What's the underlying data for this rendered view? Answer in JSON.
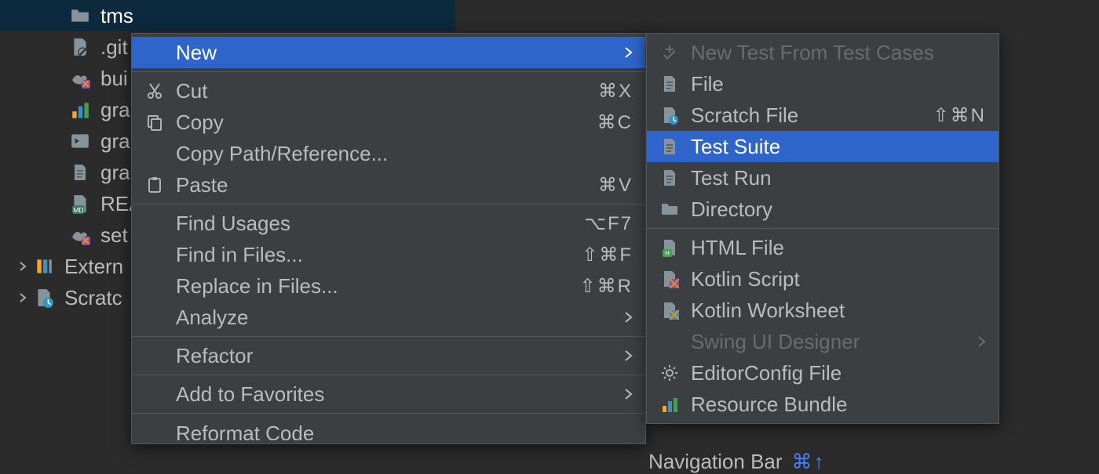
{
  "tree": {
    "selected": "tms",
    "items": [
      {
        "label": "tms",
        "icon": "folder",
        "selected": true,
        "indent": 1,
        "arrow": ""
      },
      {
        "label": ".git",
        "icon": "gitignore",
        "indent": 1,
        "arrow": ""
      },
      {
        "label": "bui",
        "icon": "gradle-kotlin",
        "indent": 1,
        "arrow": ""
      },
      {
        "label": "gra",
        "icon": "gradle-bars",
        "indent": 1,
        "arrow": ""
      },
      {
        "label": "gra",
        "icon": "terminal",
        "indent": 1,
        "arrow": ""
      },
      {
        "label": "gra",
        "icon": "file-lines",
        "indent": 1,
        "arrow": ""
      },
      {
        "label": "REA",
        "icon": "markdown",
        "indent": 1,
        "arrow": ""
      },
      {
        "label": "set",
        "icon": "gradle-kotlin",
        "indent": 1,
        "arrow": ""
      },
      {
        "label": "Extern",
        "icon": "external-lib",
        "indent": 0,
        "arrow": ">"
      },
      {
        "label": "Scratc",
        "icon": "scratch",
        "indent": 0,
        "arrow": ">"
      }
    ]
  },
  "contextMenu": {
    "items": [
      {
        "label": "New",
        "icon": "",
        "highlight": true,
        "submenu": true,
        "group": 0
      },
      {
        "label": "Cut",
        "icon": "cut",
        "shortcut": "⌘X",
        "group": 1
      },
      {
        "label": "Copy",
        "icon": "copy",
        "shortcut": "⌘C",
        "group": 1
      },
      {
        "label": "Copy Path/Reference...",
        "icon": "",
        "group": 1
      },
      {
        "label": "Paste",
        "icon": "paste",
        "shortcut": "⌘V",
        "group": 1
      },
      {
        "label": "Find Usages",
        "icon": "",
        "shortcut": "⌥F7",
        "group": 2
      },
      {
        "label": "Find in Files...",
        "icon": "",
        "shortcut": "⇧⌘F",
        "group": 2
      },
      {
        "label": "Replace in Files...",
        "icon": "",
        "shortcut": "⇧⌘R",
        "group": 2
      },
      {
        "label": "Analyze",
        "icon": "",
        "submenu": true,
        "group": 2
      },
      {
        "label": "Refactor",
        "icon": "",
        "submenu": true,
        "group": 3
      },
      {
        "label": "Add to Favorites",
        "icon": "",
        "submenu": true,
        "group": 4
      },
      {
        "label": "Reformat Code",
        "icon": "",
        "group": 5,
        "cut": true
      }
    ]
  },
  "submenu": {
    "items": [
      {
        "label": "New Test From Test Cases",
        "icon": "new-test",
        "disabled": true,
        "group": 0
      },
      {
        "label": "File",
        "icon": "file-lines",
        "group": 0
      },
      {
        "label": "Scratch File",
        "icon": "scratch-file",
        "shortcut": "⇧⌘N",
        "group": 0
      },
      {
        "label": "Test Suite",
        "icon": "file-lines",
        "highlight": true,
        "group": 0
      },
      {
        "label": "Test Run",
        "icon": "file-lines",
        "group": 0
      },
      {
        "label": "Directory",
        "icon": "folder-gray",
        "group": 0
      },
      {
        "label": "HTML File",
        "icon": "html",
        "group": 1
      },
      {
        "label": "Kotlin Script",
        "icon": "kotlin",
        "group": 1
      },
      {
        "label": "Kotlin Worksheet",
        "icon": "kotlin-ws",
        "group": 1
      },
      {
        "label": "Swing UI Designer",
        "icon": "",
        "disabled": true,
        "submenu": true,
        "group": 1
      },
      {
        "label": "EditorConfig File",
        "icon": "gear",
        "group": 1
      },
      {
        "label": "Resource Bundle",
        "icon": "resource-bundle",
        "group": 1
      }
    ]
  },
  "background": {
    "label": "Navigation Bar",
    "shortcut": "⌘↑"
  }
}
